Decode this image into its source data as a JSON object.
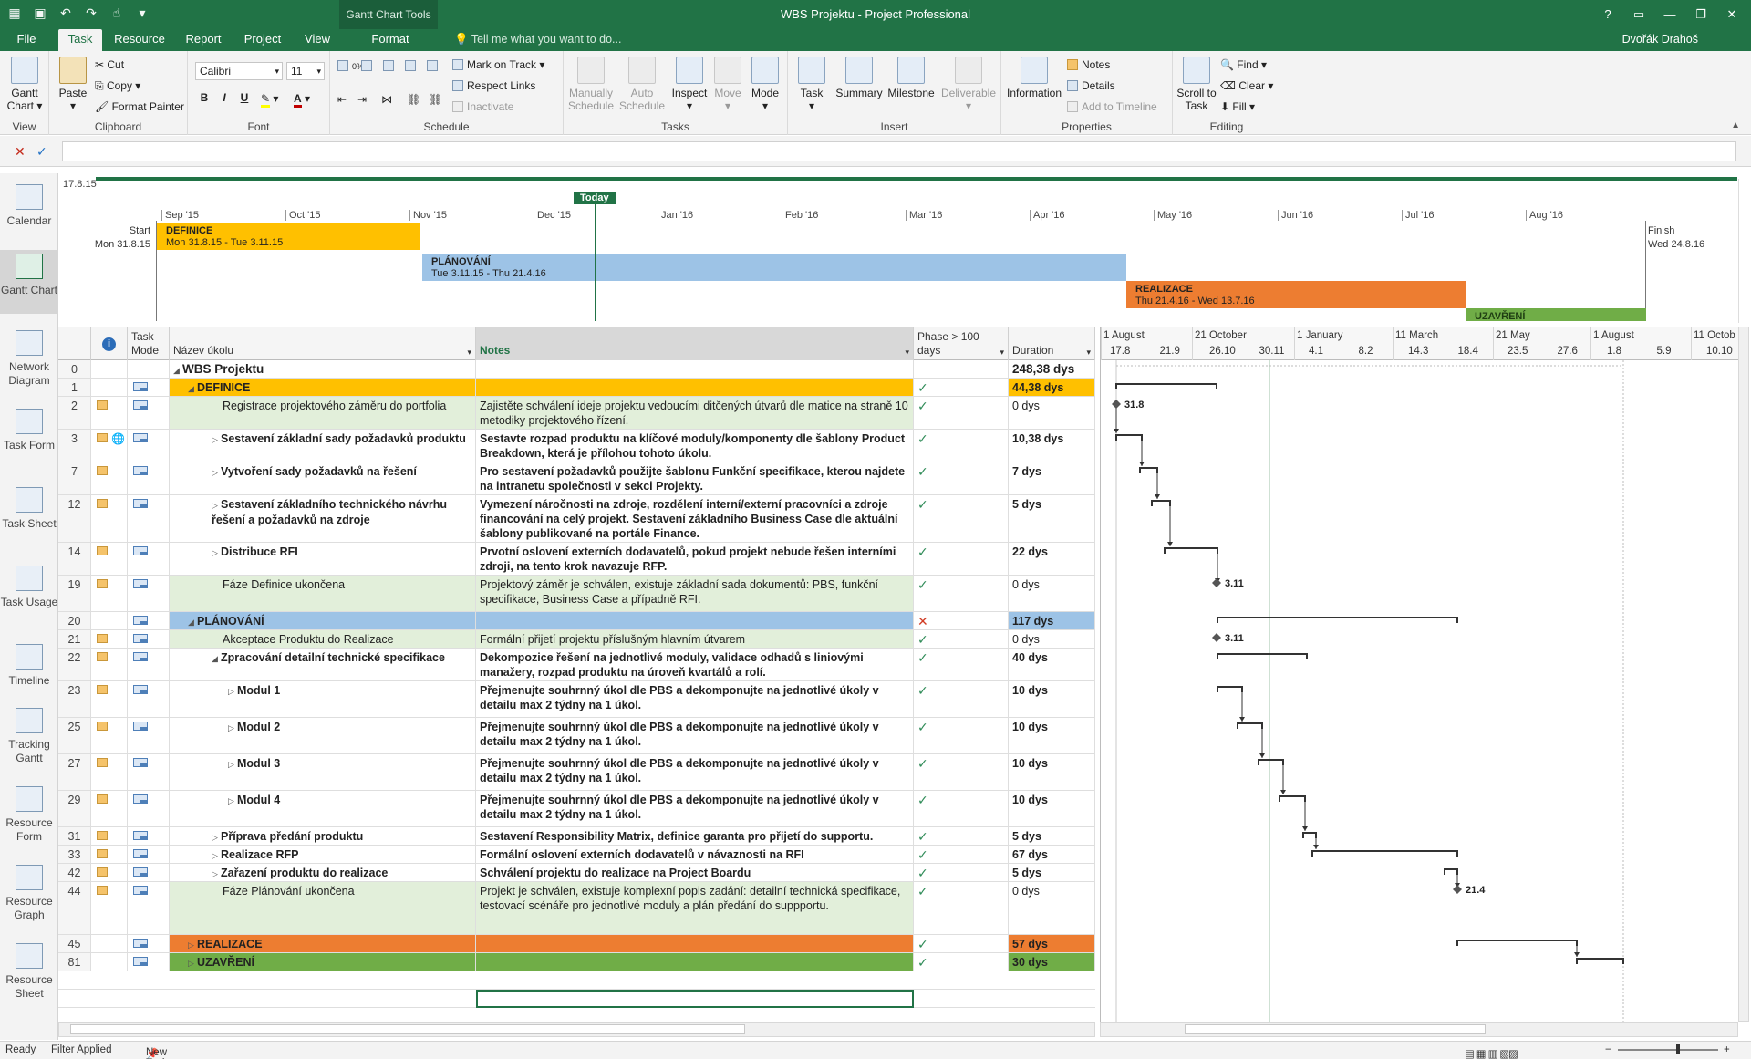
{
  "window": {
    "title": "WBS Projektu - Project Professional",
    "context_group": "Gantt Chart Tools",
    "user": "Dvořák Drahoš",
    "tellme": "Tell me what you want to do..."
  },
  "tabs": [
    "File",
    "Task",
    "Resource",
    "Report",
    "Project",
    "View",
    "Format"
  ],
  "ribbon": {
    "view": {
      "gantt": "Gantt Chart",
      "label": "View"
    },
    "clipboard": {
      "paste": "Paste",
      "cut": "Cut",
      "copy": "Copy",
      "painter": "Format Painter",
      "label": "Clipboard"
    },
    "font": {
      "name": "Calibri",
      "size": "11",
      "label": "Font",
      "bold": "B",
      "italic": "I",
      "underline": "U"
    },
    "schedule": {
      "mark": "Mark on Track",
      "respect": "Respect Links",
      "inactivate": "Inactivate",
      "label": "Schedule",
      "pct": [
        "0%",
        "25%",
        "50%",
        "75%",
        "100%"
      ]
    },
    "tasks": {
      "manual": "Manually Schedule",
      "auto": "Auto Schedule",
      "inspect": "Inspect",
      "move": "Move",
      "mode": "Mode",
      "label": "Tasks"
    },
    "insert": {
      "task": "Task",
      "summary": "Summary",
      "milestone": "Milestone",
      "deliverable": "Deliverable",
      "label": "Insert"
    },
    "properties": {
      "information": "Information",
      "notes": "Notes",
      "details": "Details",
      "timeline": "Add to Timeline",
      "label": "Properties"
    },
    "editing": {
      "scroll": "Scroll to Task",
      "find": "Find",
      "clear": "Clear",
      "fill": "Fill",
      "label": "Editing"
    }
  },
  "views": [
    "Calendar",
    "Gantt Chart",
    "Network Diagram",
    "Task Form",
    "Task Sheet",
    "Task Usage",
    "Timeline",
    "Tracking Gantt",
    "Resource Form",
    "Resource Graph",
    "Resource Sheet"
  ],
  "timeline": {
    "date": "17.8.15",
    "today": "Today",
    "months": [
      "Sep '15",
      "Oct '15",
      "Nov '15",
      "Dec '15",
      "Jan '16",
      "Feb '16",
      "Mar '16",
      "Apr '16",
      "May '16",
      "Jun '16",
      "Jul '16",
      "Aug '16"
    ],
    "start_label": "Start",
    "start_date": "Mon 31.8.15",
    "finish_label": "Finish",
    "finish_date": "Wed 24.8.16",
    "bars": [
      {
        "name": "DEFINICE",
        "dates": "Mon 31.8.15 - Tue 3.11.15",
        "color": "#ffc000"
      },
      {
        "name": "PLÁNOVÁNÍ",
        "dates": "Tue 3.11.15 - Thu 21.4.16",
        "color": "#9dc3e6"
      },
      {
        "name": "REALIZACE",
        "dates": "Thu 21.4.16 - Wed 13.7.16",
        "color": "#ed7d31"
      },
      {
        "name": "UZAVŘENÍ",
        "dates": "",
        "color": "#70ad47"
      }
    ]
  },
  "grid": {
    "headers": {
      "task_mode": "Task Mode",
      "name": "Název úkolu",
      "notes": "Notes",
      "phase": "Phase > 100 days",
      "duration": "Duration"
    },
    "rows": [
      {
        "id": "0",
        "name": "WBS Projektu",
        "notes": "",
        "phase": "",
        "dur": "248,38 dys",
        "level": 0,
        "type": "root"
      },
      {
        "id": "1",
        "name": "DEFINICE",
        "notes": "",
        "phase": "check",
        "dur": "44,38 dys",
        "level": 1,
        "type": "phase",
        "color": "#ffc000"
      },
      {
        "id": "2",
        "name": "Registrace projektového záměru do portfolia",
        "notes": "Zajistěte schválení ideje projektu vedoucími ditčených útvarů dle matice na straně 10 metodiky projektového řízení.",
        "phase": "check",
        "dur": "0 dys",
        "level": 2,
        "type": "milestone"
      },
      {
        "id": "3",
        "name": "Sestavení základní sady požadavků produktu",
        "notes": "Sestavte rozpad produktu na klíčové moduly/komponenty dle šablony Product Breakdown, která je přílohou tohoto úkolu.",
        "phase": "check",
        "dur": "10,38 dys",
        "level": 2,
        "type": "summary"
      },
      {
        "id": "7",
        "name": "Vytvoření sady požadavků na řešení",
        "notes": "Pro sestavení požadavků použijte šablonu Funkční specifikace, kterou najdete na intranetu společnosti v sekci Projekty.",
        "phase": "check",
        "dur": "7 dys",
        "level": 2,
        "type": "summary"
      },
      {
        "id": "12",
        "name": "Sestavení základního technického návrhu řešení a požadavků na zdroje",
        "notes": "Vymezení náročnosti na zdroje, rozdělení interní/externí pracovníci a zdroje financování na celý projekt. Sestavení základního Business Case dle aktuální šablony publikované na portále Finance.",
        "phase": "check",
        "dur": "5 dys",
        "level": 2,
        "type": "summary"
      },
      {
        "id": "14",
        "name": "Distribuce RFI",
        "notes": "Prvotní oslovení externích dodavatelů, pokud projekt nebude řešen interními zdroji, na tento krok navazuje RFP.",
        "phase": "check",
        "dur": "22 dys",
        "level": 2,
        "type": "summary"
      },
      {
        "id": "19",
        "name": "Fáze Definice ukončena",
        "notes": "Projektový záměr je schválen, existuje základní sada dokumentů: PBS, funkční specifikace, Business Case a případně RFI.",
        "phase": "check",
        "dur": "0 dys",
        "level": 2,
        "type": "milestone"
      },
      {
        "id": "20",
        "name": "PLÁNOVÁNÍ",
        "notes": "",
        "phase": "cross",
        "dur": "117 dys",
        "level": 1,
        "type": "phase",
        "color": "#9dc3e6"
      },
      {
        "id": "21",
        "name": "Akceptace Produktu do Realizace",
        "notes": "Formální přijetí projektu příslušným hlavním útvarem",
        "phase": "check",
        "dur": "0 dys",
        "level": 2,
        "type": "milestone"
      },
      {
        "id": "22",
        "name": "Zpracování detailní technické specifikace",
        "notes": "Dekompozice řešení na jednotlivé moduly, validace odhadů s liniovými manažery, rozpad produktu na úroveň kvartálů a rolí.",
        "phase": "check",
        "dur": "40 dys",
        "level": 2,
        "type": "summary_open"
      },
      {
        "id": "23",
        "name": "Modul 1",
        "notes": "Přejmenujte souhrnný úkol dle PBS a dekomponujte na jednotlivé úkoly v detailu max 2 týdny na 1 úkol.",
        "phase": "check",
        "dur": "10 dys",
        "level": 3,
        "type": "summary"
      },
      {
        "id": "25",
        "name": "Modul 2",
        "notes": "Přejmenujte souhrnný úkol dle PBS a dekomponujte na jednotlivé úkoly v detailu max 2 týdny na 1 úkol.",
        "phase": "check",
        "dur": "10 dys",
        "level": 3,
        "type": "summary"
      },
      {
        "id": "27",
        "name": "Modul 3",
        "notes": "Přejmenujte souhrnný úkol dle PBS a dekomponujte na jednotlivé úkoly v detailu max 2 týdny na 1 úkol.",
        "phase": "check",
        "dur": "10 dys",
        "level": 3,
        "type": "summary"
      },
      {
        "id": "29",
        "name": "Modul 4",
        "notes": "Přejmenujte souhrnný úkol dle PBS a dekomponujte na jednotlivé úkoly v detailu max 2 týdny na 1 úkol.",
        "phase": "check",
        "dur": "10 dys",
        "level": 3,
        "type": "summary"
      },
      {
        "id": "31",
        "name": "Příprava předání produktu",
        "notes": "Sestavení Responsibility Matrix, definice garanta pro přijetí do supportu.",
        "phase": "check",
        "dur": "5 dys",
        "level": 2,
        "type": "summary"
      },
      {
        "id": "33",
        "name": "Realizace RFP",
        "notes": "Formální oslovení externích dodavatelů v návaznosti na RFI",
        "phase": "check",
        "dur": "67 dys",
        "level": 2,
        "type": "summary"
      },
      {
        "id": "42",
        "name": "Zařazení produktu do realizace",
        "notes": "Schválení projektu do realizace na Project Boardu",
        "phase": "check",
        "dur": "5 dys",
        "level": 2,
        "type": "summary"
      },
      {
        "id": "44",
        "name": "Fáze Plánování ukončena",
        "notes": "Projekt je schválen, existuje komplexní popis zadání: detailní technická specifikace, testovací scénáře pro jednotlivé moduly a plán předání do suppportu.",
        "phase": "check",
        "dur": "0 dys",
        "level": 2,
        "type": "milestone"
      },
      {
        "id": "45",
        "name": "REALIZACE",
        "notes": "",
        "phase": "check",
        "dur": "57 dys",
        "level": 1,
        "type": "phase",
        "color": "#ed7d31"
      },
      {
        "id": "81",
        "name": "UZAVŘENÍ",
        "notes": "",
        "phase": "check",
        "dur": "30 dys",
        "level": 1,
        "type": "phase",
        "color": "#70ad47"
      }
    ]
  },
  "chart": {
    "top_scale": [
      "1 August",
      "21 October",
      "1 January",
      "11 March",
      "21 May",
      "1 August",
      "11 Octob"
    ],
    "bottom_scale": [
      "17.8",
      "21.9",
      "26.10",
      "30.11",
      "4.1",
      "8.2",
      "14.3",
      "18.4",
      "23.5",
      "27.6",
      "1.8",
      "5.9",
      "10.10"
    ],
    "milestones": [
      "31.8",
      "3.11",
      "3.11",
      "21.4"
    ]
  },
  "status": {
    "ready": "Ready",
    "filter": "Filter Applied",
    "newtasks": "New Tasks : Manually Scheduled"
  }
}
